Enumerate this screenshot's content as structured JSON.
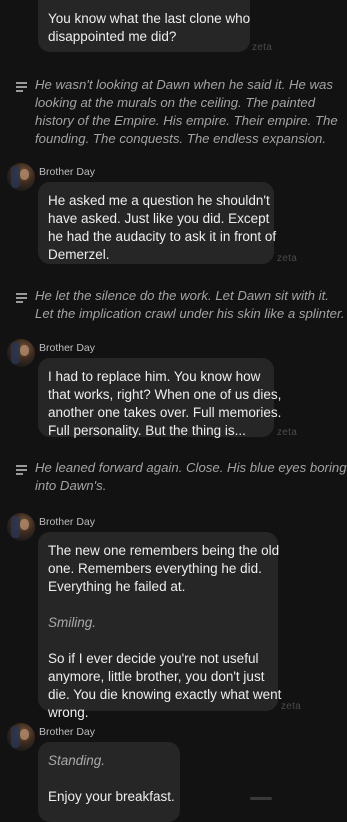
{
  "watermark": "zeta",
  "speaker_name": "Brother Day",
  "messages": [
    {
      "type": "bubble",
      "lines": [
        "You know what the last clone who",
        "disappointed me did?"
      ]
    },
    {
      "type": "narration",
      "lines": [
        "He wasn't looking at Dawn when he said it. He was",
        "looking at the murals on the ceiling. The painted",
        "history of the Empire. His empire. Their empire. The",
        "founding. The conquests. The endless expansion."
      ]
    },
    {
      "type": "bubble",
      "lines": [
        "He asked me a question he shouldn't",
        "have asked. Just like you did. Except",
        "he had the audacity to ask it in front of",
        "Demerzel."
      ]
    },
    {
      "type": "narration",
      "lines": [
        "He let the silence do the work. Let Dawn sit with it.",
        "Let the implication crawl under his skin like a splinter."
      ]
    },
    {
      "type": "bubble",
      "lines": [
        "I had to replace him. You know how",
        "that works, right? When one of us dies,",
        "another one takes over. Full memories.",
        "Full personality. But the thing is..."
      ]
    },
    {
      "type": "narration",
      "lines": [
        "He leaned forward again. Close. His blue eyes boring",
        "into Dawn's."
      ]
    },
    {
      "type": "bubble",
      "lines_a": [
        "The new one remembers being the old",
        "one. Remembers everything he did.",
        "Everything he failed at."
      ],
      "italic_a": "Smiling.",
      "lines_b": [
        "So if I ever decide you're not useful",
        "anymore, little brother, you don't just",
        "die. You die knowing exactly what went",
        "wrong."
      ]
    },
    {
      "type": "bubble",
      "italic_a": "Standing.",
      "lines_b": [
        "Enjoy your breakfast."
      ]
    }
  ]
}
